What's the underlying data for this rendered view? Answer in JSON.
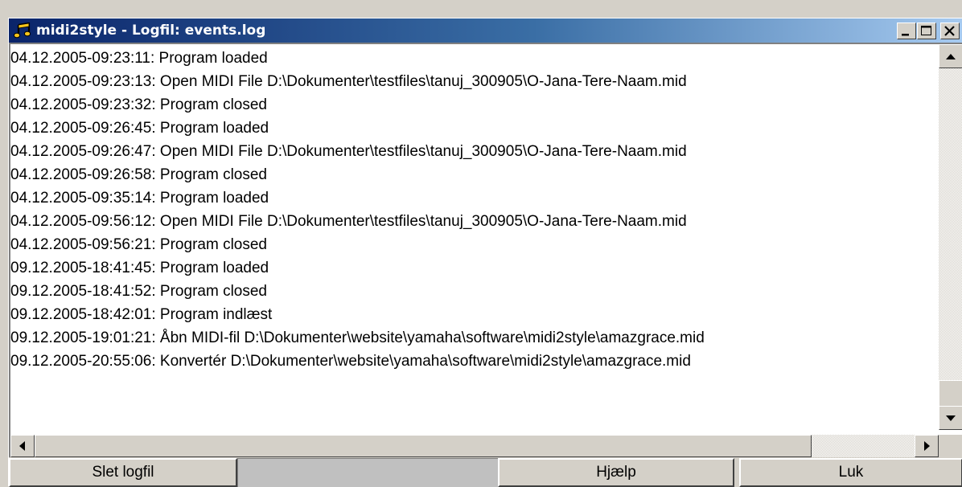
{
  "window": {
    "title": "midi2style - Logfil: events.log",
    "icon": "music-note-icon"
  },
  "title_buttons": [
    "minimize-icon",
    "maximize-icon",
    "close-icon"
  ],
  "log": {
    "lines": [
      "04.12.2005-09:23:11: Program loaded",
      "04.12.2005-09:23:13: Open MIDI File D:\\Dokumenter\\testfiles\\tanuj_300905\\O-Jana-Tere-Naam.mid",
      "04.12.2005-09:23:32: Program closed",
      "04.12.2005-09:26:45: Program loaded",
      "04.12.2005-09:26:47: Open MIDI File D:\\Dokumenter\\testfiles\\tanuj_300905\\O-Jana-Tere-Naam.mid",
      "04.12.2005-09:26:58: Program closed",
      "04.12.2005-09:35:14: Program loaded",
      "04.12.2005-09:56:12: Open MIDI File D:\\Dokumenter\\testfiles\\tanuj_300905\\O-Jana-Tere-Naam.mid",
      "04.12.2005-09:56:21: Program closed",
      "09.12.2005-18:41:45: Program loaded",
      "09.12.2005-18:41:52: Program closed",
      "09.12.2005-18:42:01: Program indlæst",
      "09.12.2005-19:01:21: Åbn MIDI-fil D:\\Dokumenter\\website\\yamaha\\software\\midi2style\\amazgrace.mid",
      "09.12.2005-20:55:06: Konvertér D:\\Dokumenter\\website\\yamaha\\software\\midi2style\\amazgrace.mid"
    ]
  },
  "buttons": {
    "delete_log": "Slet logfil",
    "help": "Hjælp",
    "close": "Luk"
  },
  "colors": {
    "title_start": "#0a246a",
    "title_end": "#a6caf0",
    "face": "#d4d0c8"
  }
}
